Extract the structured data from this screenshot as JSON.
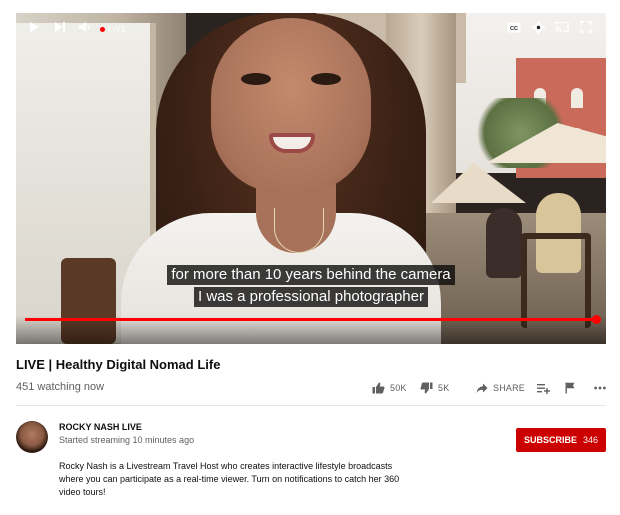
{
  "video": {
    "captions": [
      "for more than 10 years behind the camera",
      "I was a professional photographer"
    ],
    "live_label": "LIVE",
    "progress_fraction": 1.0,
    "controls": [
      "play-icon",
      "next-icon",
      "volume-icon",
      "captions-icon",
      "settings-icon",
      "cast-icon",
      "fullscreen-icon"
    ]
  },
  "meta": {
    "title": "LIVE | Healthy Digital Nomad Life",
    "views": "451 watching now"
  },
  "actions": {
    "like_count": "50K",
    "dislike_count": "5K",
    "share_label": "SHARE"
  },
  "channel": {
    "name": "ROCKY NASH LIVE",
    "started": "Started streaming 10 minutes ago",
    "subscribe_label": "SUBSCRIBE",
    "subscriber_count": "346",
    "description": "Rocky Nash is a Livestream Travel Host who creates interactive lifestyle broadcasts where you can participate as a real-time viewer. Turn on notifications to catch her 360 video tours!"
  },
  "colors": {
    "brand_red": "#ff0000",
    "subscribe_red": "#cc0000",
    "muted_text": "#606060"
  }
}
